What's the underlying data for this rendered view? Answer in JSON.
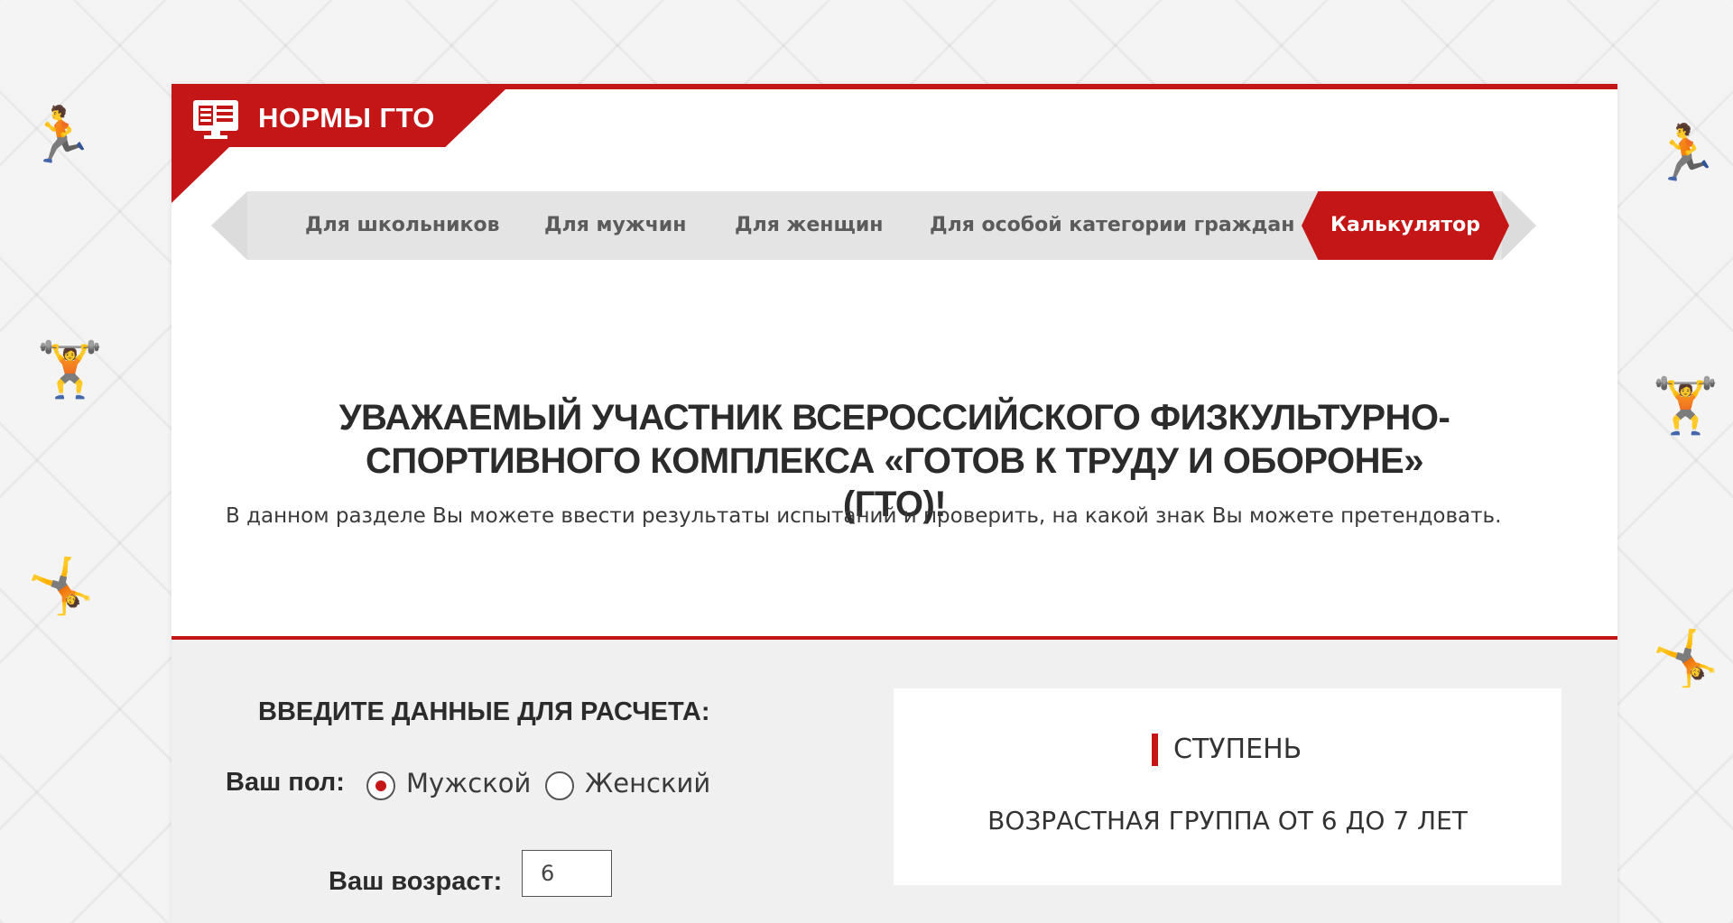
{
  "header": {
    "title": "НОРМЫ ГТО"
  },
  "nav": {
    "items": [
      {
        "label": "Для школьников"
      },
      {
        "label": "Для мужчин"
      },
      {
        "label": "Для женщин"
      },
      {
        "label": "Для особой категории граждан"
      },
      {
        "label": "Калькулятор",
        "active": true
      }
    ]
  },
  "main": {
    "greeting": "УВАЖАЕМЫЙ УЧАСТНИК ВСЕРОССИЙСКОГО ФИЗКУЛЬТУРНО-СПОРТИВНОГО КОМПЛЕКСА «ГОТОВ К ТРУДУ И ОБОРОНЕ» (ГТО)!",
    "intro": "В данном разделе Вы можете ввести результаты испытаний и проверить, на какой знак Вы можете претендовать."
  },
  "calculator": {
    "title": "ВВЕДИТЕ ДАННЫЕ ДЛЯ РАСЧЕТА:",
    "gender_label": "Ваш пол:",
    "gender_options": [
      {
        "label": "Мужской",
        "checked": true
      },
      {
        "label": "Женский",
        "checked": false
      }
    ],
    "age_label": "Ваш возраст:",
    "age_value": "6"
  },
  "result": {
    "step_label": "СТУПЕНЬ",
    "age_group": "ВОЗРАСТНАЯ ГРУППА ОТ 6 ДО 7 ЛЕТ"
  },
  "colors": {
    "accent": "#c41616",
    "nav_bg": "#e4e4e4",
    "calc_bg": "#f0f0f0"
  }
}
